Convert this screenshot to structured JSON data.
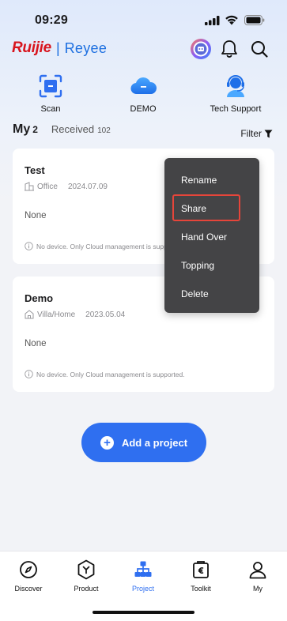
{
  "status_bar": {
    "time": "09:29"
  },
  "brand": {
    "name_red": "Ruijie",
    "separator": "|",
    "name_blue": "Reyee"
  },
  "header_icons": [
    "avatar-badge-icon",
    "bell-icon",
    "search-icon"
  ],
  "quick_actions": [
    {
      "label": "Scan",
      "icon": "scan-icon"
    },
    {
      "label": "DEMO",
      "icon": "cloud-icon"
    },
    {
      "label": "Tech Support",
      "icon": "support-agent-icon"
    }
  ],
  "tabs": {
    "my": {
      "label": "My",
      "count": "2"
    },
    "received": {
      "label": "Received",
      "count": "102"
    }
  },
  "filter": {
    "label": "Filter"
  },
  "projects": [
    {
      "name": "Test",
      "type": "Office",
      "date": "2024.07.09",
      "devices": "None",
      "info": "No device. Only Cloud management is supported."
    },
    {
      "name": "Demo",
      "type": "Villa/Home",
      "date": "2023.05.04",
      "devices": "None",
      "info": "No device. Only Cloud management is supported."
    }
  ],
  "context_menu": {
    "items": [
      "Rename",
      "Share",
      "Hand Over",
      "Topping",
      "Delete"
    ],
    "highlighted": "Share",
    "highlight_color": "#e6453a"
  },
  "add_project": {
    "label": "Add a project"
  },
  "bottom_nav": {
    "items": [
      {
        "label": "Discover",
        "icon": "compass-icon"
      },
      {
        "label": "Product",
        "icon": "product-hex-icon"
      },
      {
        "label": "Project",
        "icon": "project-tree-icon"
      },
      {
        "label": "Toolkit",
        "icon": "toolkit-icon"
      },
      {
        "label": "My",
        "icon": "person-icon"
      }
    ],
    "active": "Project"
  },
  "colors": {
    "accent": "#2f6ff0",
    "brand_red": "#d8141d",
    "menu_bg": "#444446"
  }
}
